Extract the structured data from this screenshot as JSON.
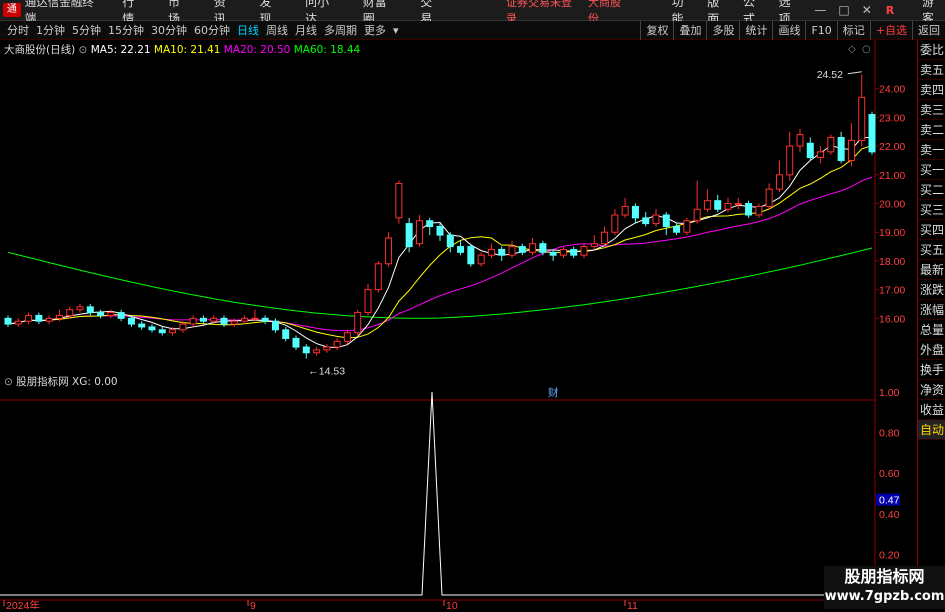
{
  "topbar": {
    "app_title": "通达信金融终端",
    "menu": [
      "行情",
      "市场",
      "资讯",
      "发现",
      "问小达",
      "财富圈",
      "交易"
    ],
    "warning": "证券交易未登录",
    "stock": "大商股份",
    "right_menu": [
      "功能",
      "版面",
      "公式",
      "选项"
    ],
    "win_min": "—",
    "win_max": "□",
    "win_close": "✕",
    "r_button": "R",
    "guest": "游客",
    "logo": "通"
  },
  "toolbar": {
    "periods": [
      "分时",
      "1分钟",
      "5分钟",
      "15分钟",
      "30分钟",
      "60分钟",
      "日线",
      "周线",
      "月线",
      "多周期",
      "更多"
    ],
    "active": "日线",
    "right": [
      "复权",
      "叠加",
      "多股",
      "统计",
      "画线",
      "F10",
      "标记",
      "+自选",
      "返回"
    ]
  },
  "legend": {
    "name": "大商股份(日线)",
    "ma5": "MA5: 22.21",
    "ma10": "MA10: 21.41",
    "ma20": "MA20: 20.50",
    "ma60": "MA60: 18.44"
  },
  "legend2": {
    "name": "股朋指标网",
    "xg": "XG: 0.00"
  },
  "sidebar": [
    "委比",
    "卖五",
    "卖四",
    "卖三",
    "卖二",
    "卖一",
    "买一",
    "买二",
    "买三",
    "买四",
    "买五",
    "最新",
    "涨跌",
    "涨幅",
    "总量",
    "外盘",
    "换手",
    "净资",
    "收益",
    "自动"
  ],
  "price_axis": [
    "24.00",
    "23.00",
    "22.00",
    "21.00",
    "20.00",
    "19.00",
    "18.00",
    "17.00",
    "16.00"
  ],
  "indicator_axis": [
    "1.00",
    "0.80",
    "0.60",
    "0.47",
    "0.40",
    "0.20"
  ],
  "time_axis": [
    "2024年",
    "9",
    "10",
    "11"
  ],
  "annotations": {
    "high": "24.52",
    "low": "14.53",
    "fin": "财"
  },
  "watermark": {
    "line1": "股朋指标网",
    "line2": "www.7gpzb.com"
  },
  "colors": {
    "ma5": "#ffffff",
    "ma10": "#ffff00",
    "ma20": "#ff00ff",
    "ma60": "#00ff00",
    "up": "#ff3030",
    "down": "#54ffff"
  },
  "chart_data": {
    "type": "candlestick",
    "xg_values_peak": 1.0,
    "price_range": [
      14.5,
      24.6
    ],
    "candles": [
      [
        16.0,
        15.8,
        16.1,
        15.7
      ],
      [
        15.8,
        15.9,
        16.0,
        15.7
      ],
      [
        15.9,
        16.1,
        16.2,
        15.8
      ],
      [
        16.1,
        15.9,
        16.2,
        15.8
      ],
      [
        15.9,
        16.0,
        16.1,
        15.8
      ],
      [
        16.0,
        16.1,
        16.3,
        15.9
      ],
      [
        16.1,
        16.3,
        16.4,
        16.0
      ],
      [
        16.3,
        16.4,
        16.5,
        16.2
      ],
      [
        16.4,
        16.2,
        16.5,
        16.1
      ],
      [
        16.2,
        16.1,
        16.3,
        16.0
      ],
      [
        16.1,
        16.2,
        16.3,
        16.0
      ],
      [
        16.2,
        16.0,
        16.3,
        15.9
      ],
      [
        16.0,
        15.8,
        16.1,
        15.7
      ],
      [
        15.8,
        15.7,
        15.9,
        15.6
      ],
      [
        15.7,
        15.6,
        15.8,
        15.5
      ],
      [
        15.6,
        15.5,
        15.7,
        15.4
      ],
      [
        15.5,
        15.6,
        15.7,
        15.4
      ],
      [
        15.6,
        15.8,
        15.9,
        15.5
      ],
      [
        15.8,
        16.0,
        16.1,
        15.7
      ],
      [
        16.0,
        15.9,
        16.1,
        15.8
      ],
      [
        15.9,
        16.0,
        16.1,
        15.8
      ],
      [
        16.0,
        15.8,
        16.1,
        15.7
      ],
      [
        15.8,
        15.9,
        16.0,
        15.7
      ],
      [
        15.9,
        16.0,
        16.1,
        15.8
      ],
      [
        16.0,
        16.0,
        16.3,
        15.9
      ],
      [
        16.0,
        15.9,
        16.1,
        15.8
      ],
      [
        15.9,
        15.6,
        16.0,
        15.5
      ],
      [
        15.6,
        15.3,
        15.7,
        15.2
      ],
      [
        15.3,
        15.0,
        15.4,
        14.9
      ],
      [
        15.0,
        14.8,
        15.1,
        14.6
      ],
      [
        14.8,
        14.9,
        15.0,
        14.7
      ],
      [
        14.9,
        15.0,
        15.1,
        14.8
      ],
      [
        15.0,
        15.2,
        15.3,
        14.9
      ],
      [
        15.2,
        15.5,
        15.6,
        15.1
      ],
      [
        15.5,
        16.2,
        16.3,
        15.4
      ],
      [
        16.2,
        17.0,
        17.2,
        16.1
      ],
      [
        17.0,
        17.9,
        18.0,
        16.9
      ],
      [
        17.9,
        18.8,
        19.0,
        17.8
      ],
      [
        19.5,
        20.7,
        20.8,
        19.3
      ],
      [
        19.3,
        18.5,
        19.5,
        18.3
      ],
      [
        18.6,
        19.4,
        19.6,
        18.5
      ],
      [
        19.4,
        19.2,
        19.5,
        18.9
      ],
      [
        19.2,
        18.9,
        19.3,
        18.7
      ],
      [
        18.9,
        18.5,
        19.0,
        18.3
      ],
      [
        18.5,
        18.3,
        18.7,
        18.2
      ],
      [
        18.5,
        17.9,
        18.6,
        17.8
      ],
      [
        17.9,
        18.2,
        18.3,
        17.8
      ],
      [
        18.2,
        18.4,
        18.6,
        18.1
      ],
      [
        18.4,
        18.2,
        18.5,
        18.0
      ],
      [
        18.2,
        18.5,
        18.7,
        18.1
      ],
      [
        18.5,
        18.3,
        18.6,
        18.2
      ],
      [
        18.3,
        18.6,
        18.8,
        18.2
      ],
      [
        18.6,
        18.3,
        18.7,
        18.2
      ],
      [
        18.3,
        18.2,
        18.4,
        18.0
      ],
      [
        18.2,
        18.4,
        18.5,
        18.1
      ],
      [
        18.4,
        18.2,
        18.5,
        18.1
      ],
      [
        18.2,
        18.5,
        18.6,
        18.1
      ],
      [
        18.5,
        18.6,
        18.9,
        18.4
      ],
      [
        18.6,
        19.0,
        19.2,
        18.5
      ],
      [
        19.0,
        19.6,
        19.8,
        18.9
      ],
      [
        19.6,
        19.9,
        20.2,
        19.5
      ],
      [
        19.9,
        19.5,
        20.0,
        19.3
      ],
      [
        19.5,
        19.3,
        19.7,
        19.2
      ],
      [
        19.3,
        19.6,
        19.8,
        19.2
      ],
      [
        19.6,
        19.2,
        19.7,
        18.9
      ],
      [
        19.2,
        19.0,
        19.3,
        18.9
      ],
      [
        19.0,
        19.4,
        19.5,
        18.9
      ],
      [
        19.4,
        19.8,
        20.8,
        19.3
      ],
      [
        19.8,
        20.1,
        20.5,
        19.7
      ],
      [
        20.1,
        19.8,
        20.3,
        19.7
      ],
      [
        19.8,
        20.0,
        20.2,
        19.7
      ],
      [
        20.0,
        20.0,
        20.2,
        19.8
      ],
      [
        20.0,
        19.6,
        20.1,
        19.5
      ],
      [
        19.6,
        19.9,
        20.0,
        19.5
      ],
      [
        19.9,
        20.5,
        20.7,
        19.8
      ],
      [
        20.5,
        21.0,
        21.5,
        20.4
      ],
      [
        21.0,
        22.0,
        22.5,
        20.8
      ],
      [
        22.0,
        22.4,
        22.6,
        21.8
      ],
      [
        22.1,
        21.6,
        22.3,
        21.5
      ],
      [
        21.6,
        21.8,
        22.0,
        21.4
      ],
      [
        21.8,
        22.3,
        22.4,
        21.7
      ],
      [
        22.3,
        21.5,
        22.5,
        21.4
      ],
      [
        21.5,
        22.2,
        22.8,
        21.3
      ],
      [
        22.2,
        23.7,
        24.5,
        22.0
      ],
      [
        23.1,
        21.8,
        23.2,
        21.7
      ]
    ]
  }
}
